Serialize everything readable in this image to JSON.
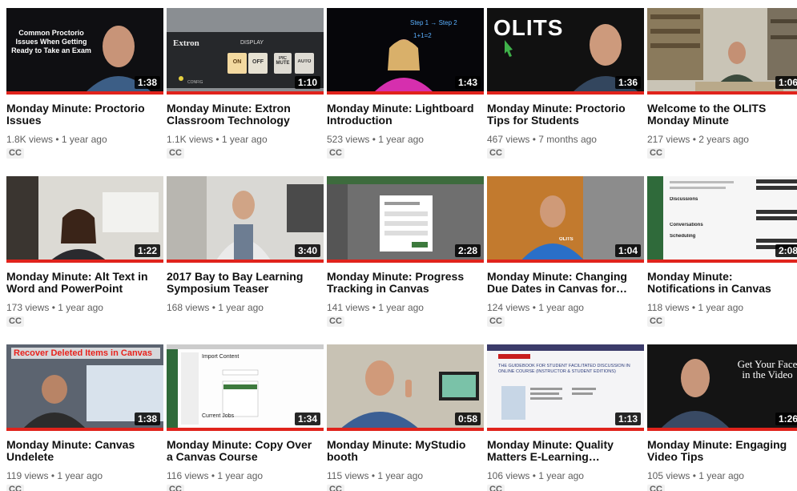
{
  "videos": [
    {
      "title": "Monday Minute: Proctorio Issues",
      "duration": "1:38",
      "views": "1.8K views",
      "age": "1 year ago",
      "badge": "CC",
      "thumb_text": "Common Proctorio Issues When Getting Ready to Take an Exam"
    },
    {
      "title": "Monday Minute: Extron Classroom Technology",
      "duration": "1:10",
      "views": "1.1K views",
      "age": "1 year ago",
      "badge": "CC",
      "thumb_brand": "Extron",
      "thumb_display": "DISPLAY",
      "thumb_on": "ON",
      "thumb_off": "OFF",
      "thumb_pic": "PIC MUTE",
      "thumb_auto": "AUTO",
      "thumb_config": "CONFIG"
    },
    {
      "title": "Monday Minute: Lightboard Introduction",
      "duration": "1:43",
      "views": "523 views",
      "age": "1 year ago",
      "badge": "CC",
      "thumb_step": "Step 1 → Step 2",
      "thumb_eq": "1+1=2"
    },
    {
      "title": "Monday Minute: Proctorio Tips for Students",
      "duration": "1:36",
      "views": "467 views",
      "age": "7 months ago",
      "badge": "CC",
      "thumb_logo": "OLITS"
    },
    {
      "title": "Welcome to the OLITS Monday Minute",
      "duration": "1:06",
      "views": "217 views",
      "age": "2 years ago",
      "badge": "CC"
    },
    {
      "title": "Monday Minute: Alt Text in Word and PowerPoint",
      "duration": "1:22",
      "views": "173 views",
      "age": "1 year ago",
      "badge": "CC"
    },
    {
      "title": "2017 Bay to Bay Learning Symposium Teaser",
      "duration": "3:40",
      "views": "168 views",
      "age": "1 year ago",
      "badge": ""
    },
    {
      "title": "Monday Minute: Progress Tracking in Canvas",
      "duration": "2:28",
      "views": "141 views",
      "age": "1 year ago",
      "badge": "CC"
    },
    {
      "title": "Monday Minute: Changing Due Dates in Canvas for…",
      "duration": "1:04",
      "views": "124 views",
      "age": "1 year ago",
      "badge": "CC",
      "thumb_logo": "OLITS"
    },
    {
      "title": "Monday Minute: Notifications in Canvas",
      "duration": "2:08",
      "views": "118 views",
      "age": "1 year ago",
      "badge": "CC",
      "thumb_sections": [
        "Discussions",
        "Conversations",
        "Scheduling"
      ]
    },
    {
      "title": "Monday Minute: Canvas Undelete",
      "duration": "1:38",
      "views": "119 views",
      "age": "1 year ago",
      "badge": "CC",
      "thumb_text": "Recover Deleted Items in Canvas"
    },
    {
      "title": "Monday Minute: Copy Over a Canvas Course",
      "duration": "1:34",
      "views": "116 views",
      "age": "1 year ago",
      "badge": "CC",
      "thumb_heading": "Import Content",
      "thumb_sub": "Current Jobs"
    },
    {
      "title": "Monday Minute: MyStudio booth",
      "duration": "0:58",
      "views": "115 views",
      "age": "1 year ago",
      "badge": "CC"
    },
    {
      "title": "Monday Minute: Quality Matters E-Learning…",
      "duration": "1:13",
      "views": "106 views",
      "age": "1 year ago",
      "badge": "CC",
      "thumb_doc": "THE GUIDEBOOK FOR STUDENT FACILITATED DISCUSSION IN ONLINE COURSE (INSTRUCTOR & STUDENT EDITIONS)"
    },
    {
      "title": "Monday Minute: Engaging Video Tips",
      "duration": "1:26",
      "views": "105 views",
      "age": "1 year ago",
      "badge": "CC",
      "thumb_text": "Get Your Face in the Video"
    }
  ],
  "separator": "•",
  "colors": {
    "progress": "#e0231c",
    "title": "#111111",
    "meta": "#606060",
    "badge_bg": "#f1f1f1"
  }
}
